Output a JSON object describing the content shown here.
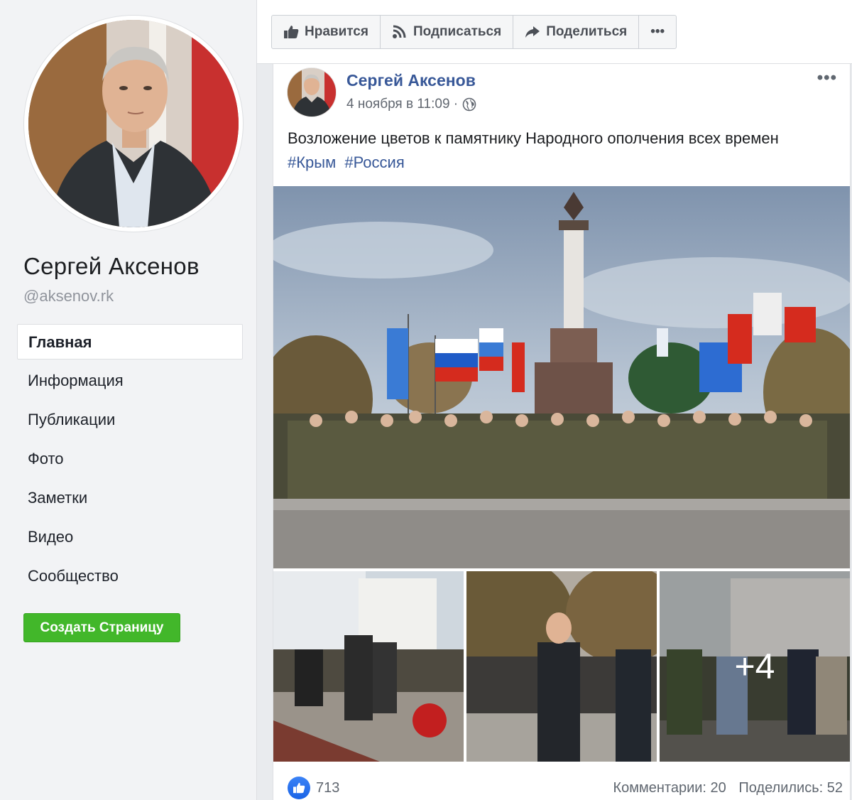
{
  "sidebar": {
    "name": "Сергей Аксенов",
    "handle": "@aksenov.rk",
    "items": [
      {
        "label": "Главная"
      },
      {
        "label": "Информация"
      },
      {
        "label": "Публикации"
      },
      {
        "label": "Фото"
      },
      {
        "label": "Заметки"
      },
      {
        "label": "Видео"
      },
      {
        "label": "Сообщество"
      }
    ],
    "create_page_label": "Создать Страницу"
  },
  "actionbar": {
    "like_label": "Нравится",
    "follow_label": "Подписаться",
    "share_label": "Поделиться",
    "more_label": "•••"
  },
  "post": {
    "author": "Сергей Аксенов",
    "timestamp": "4 ноября в 11:09 ·",
    "more_label": "•••",
    "text": "Возложение цветов к памятнику Народного ополчения всех времен",
    "tags": [
      "#Крым",
      "#Россия"
    ],
    "extra_photos_label": "+4",
    "likes_count": "713",
    "comments_label": "Комментарии: 20",
    "shares_label": "Поделились: 52"
  },
  "colors": {
    "link": "#385898",
    "create_button": "#42b72a",
    "background": "#e9ebee"
  }
}
